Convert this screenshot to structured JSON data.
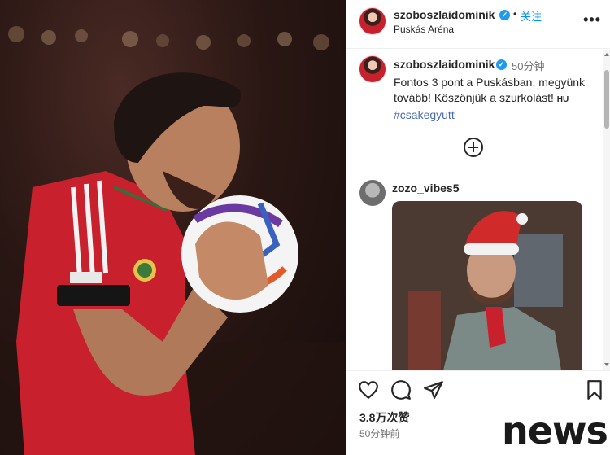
{
  "header": {
    "username": "szoboszlaidominik",
    "dot": "•",
    "follow_label": "关注",
    "location": "Puskás Aréna",
    "more_label": "•••"
  },
  "caption": {
    "username": "szoboszlaidominik",
    "time": "50分钟",
    "text": "Fontos 3 pont a Puskásban, megyünk tovább! Köszönjük a szurkolást! ",
    "flag": "HU",
    "hashtag": "#csakegyutt"
  },
  "comment": {
    "username": "zozo_vibes5"
  },
  "post": {
    "likes": "3.8万次赞",
    "time": "50分钟前"
  },
  "watermark": "news",
  "icons": {
    "verified": "verified-badge-icon",
    "load_more": "plus-circle-icon",
    "like": "heart-icon",
    "comment": "comment-bubble-icon",
    "share": "paper-plane-icon",
    "save": "bookmark-icon"
  },
  "colors": {
    "accent": "#0095f6",
    "verified": "#1d9bf0",
    "hashtag": "#4a6cb3",
    "jersey": "#c8202c"
  }
}
